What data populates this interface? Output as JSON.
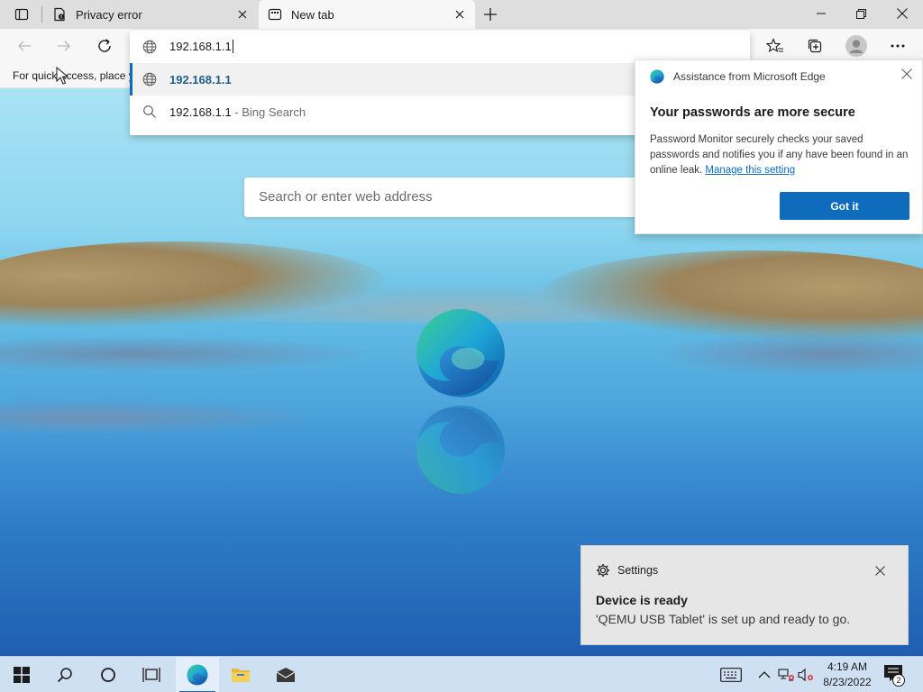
{
  "tabs": [
    {
      "title": "Privacy error",
      "icon": "privacy-error-icon"
    },
    {
      "title": "New tab",
      "icon": "new-tab-icon",
      "active": true
    }
  ],
  "address_bar": {
    "value": "192.168.1.1"
  },
  "suggestions": [
    {
      "text": "192.168.1.1",
      "icon": "globe-icon",
      "selected": true
    },
    {
      "text": "192.168.1.1",
      "suffix": " - Bing Search",
      "icon": "search-icon"
    }
  ],
  "favorites_bar": {
    "hint": "For quick access, place y"
  },
  "new_tab_page": {
    "search_placeholder": "Search or enter web address"
  },
  "assistance_popup": {
    "header": "Assistance from Microsoft Edge",
    "title": "Your passwords are more secure",
    "body": "Password Monitor securely checks your saved passwords and notifies you if any have been found in an online leak.",
    "link": "Manage this setting",
    "button": "Got it"
  },
  "toast": {
    "app": "Settings",
    "title": "Device is ready",
    "message": "'QEMU USB Tablet' is set up and ready to go."
  },
  "taskbar": {
    "time": "4:19 AM",
    "date": "8/23/2022",
    "notification_count": "2",
    "pinned": [
      "start-icon",
      "search-icon",
      "cortana-icon",
      "task-view-icon",
      "edge-icon",
      "file-explorer-icon",
      "mail-icon"
    ]
  },
  "colors": {
    "accent": "#0f6cbd",
    "suggestion_text": "#1d5f8a",
    "taskbar": "#cfe0f3",
    "toast_bg": "#e6e6e6"
  }
}
